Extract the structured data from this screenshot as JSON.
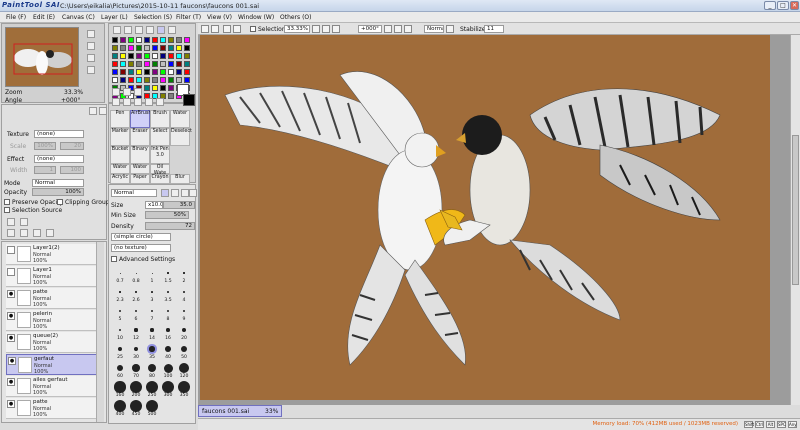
{
  "window": {
    "logo": "PaintTool SAI",
    "title": "C:\\Users\\eikalia\\Pictures\\2015-10-11 faucons\\faucons 001.sai",
    "min": "_",
    "max": "□",
    "close": "✕"
  },
  "menu": [
    "File (F)",
    "Edit (E)",
    "Canvas (C)",
    "Layer (L)",
    "Selection (S)",
    "Filter (T)",
    "View (V)",
    "Window (W)",
    "Others (O)"
  ],
  "navigator": {
    "zoom_label": "Zoom",
    "zoom_value": "33.3%",
    "angle_label": "Angle",
    "angle_value": "+000°"
  },
  "layer_props": {
    "texture_label": "Texture",
    "texture_value": "(none)",
    "scale_label": "Scale",
    "scale_value": "100%",
    "scale_num": "20",
    "effect_label": "Effect",
    "effect_value": "(none)",
    "width_label": "Width",
    "width_value": "1",
    "width_num": "100",
    "mode_label": "Mode",
    "mode_value": "Normal",
    "opacity_label": "Opacity",
    "opacity_value": "100%",
    "preserve_opacity": "Preserve Opacity",
    "clipping_group": "Clipping Group",
    "selection_source": "Selection Source"
  },
  "layers": [
    {
      "name": "Layer1(2)",
      "mode": "Normal",
      "opacity": "100%",
      "visible": false,
      "selected": false
    },
    {
      "name": "Layer1",
      "mode": "Normal",
      "opacity": "100%",
      "visible": false,
      "selected": false
    },
    {
      "name": "patte",
      "mode": "Normal",
      "opacity": "100%",
      "visible": true,
      "selected": false
    },
    {
      "name": "pelerin",
      "mode": "Normal",
      "opacity": "100%",
      "visible": true,
      "selected": false
    },
    {
      "name": "queue(2)",
      "mode": "Normal",
      "opacity": "100%",
      "visible": true,
      "selected": false
    },
    {
      "name": "gerfaut",
      "mode": "Normal",
      "opacity": "100%",
      "visible": true,
      "selected": true
    },
    {
      "name": "ailes gerfaut",
      "mode": "Normal",
      "opacity": "100%",
      "visible": true,
      "selected": false
    },
    {
      "name": "patte",
      "mode": "Normal",
      "opacity": "100%",
      "visible": true,
      "selected": false
    }
  ],
  "tools": [
    [
      "Pen",
      "AirBrush",
      "Brush",
      "Water"
    ],
    [
      "Marker",
      "Eraser",
      "Select",
      "Deselect"
    ],
    [
      "Bucket",
      "Binary",
      "Ink Pen",
      ""
    ],
    [
      "Water",
      "Water",
      "Oil Wate",
      ""
    ],
    [
      "Acrylic",
      "Paper",
      "Crayon",
      "Blur"
    ]
  ],
  "tool_nums": [
    "",
    "",
    "3.0",
    ""
  ],
  "tool_nums2": [
    "",
    "10",
    "",
    ""
  ],
  "brush": {
    "mode": "Normal",
    "size_label": "Size",
    "size_mult": "x10.0",
    "size_value": "35.0",
    "minsize_label": "Min Size",
    "minsize_value": "50%",
    "density_label": "Density",
    "density_value": "72",
    "shape": "(simple circle)",
    "texture": "(no texture)",
    "advanced": "Advanced Settings",
    "sizes": [
      "0.7",
      "0.8",
      "1",
      "1.5",
      "2",
      "2.3",
      "2.6",
      "3",
      "3.5",
      "4",
      "5",
      "6",
      "7",
      "8",
      "9",
      "10",
      "12",
      "14",
      "16",
      "20",
      "25",
      "30",
      "35",
      "40",
      "50",
      "60",
      "70",
      "80",
      "100",
      "120",
      "160",
      "200",
      "250",
      "300",
      "350",
      "400",
      "450",
      "500"
    ]
  },
  "canvas_toolbar": {
    "selection": "Selection",
    "zoom": "33.33%",
    "angle": "+000°",
    "mode": "Normal",
    "stabilize_label": "Stabilize",
    "stabilize_value": "11"
  },
  "file_tab": {
    "name": "faucons 001.sai",
    "zoom": "33%"
  },
  "status": {
    "memory": "Memory load: 70% (412MB used / 1023MB reserved)",
    "keys": [
      "Shift",
      "Ctrl",
      "Alt",
      "SPC",
      "Any"
    ]
  }
}
